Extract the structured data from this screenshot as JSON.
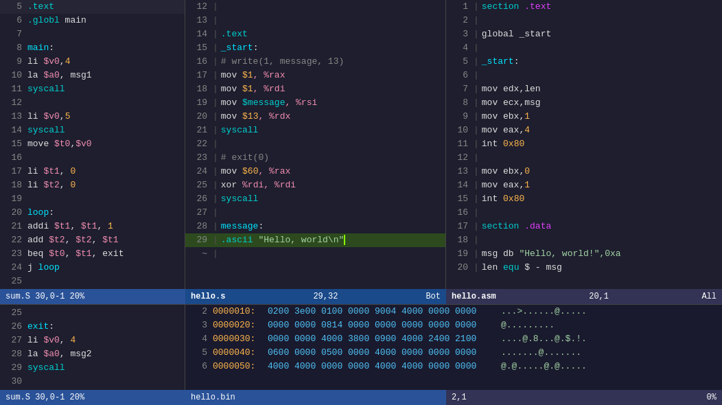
{
  "colors": {
    "bg": "#1e1e2e",
    "status_blue": "#2a5298",
    "status_dark": "#1a4a8a"
  },
  "pane_left": {
    "lines": [
      {
        "num": "5",
        "content": [
          {
            "t": "  .text",
            "c": "c-cyan"
          }
        ]
      },
      {
        "num": "6",
        "content": [
          {
            "t": "  .globl ",
            "c": "c-cyan"
          },
          {
            "t": "main",
            "c": "c-white"
          }
        ]
      },
      {
        "num": "7",
        "content": []
      },
      {
        "num": "8",
        "content": [
          {
            "t": "main",
            "c": "c-label"
          },
          {
            "t": ":",
            "c": "c-white"
          }
        ]
      },
      {
        "num": "9",
        "content": [
          {
            "t": "  li ",
            "c": "c-white"
          },
          {
            "t": "$v0",
            "c": "c-reg"
          },
          {
            "t": ",",
            "c": "c-white"
          },
          {
            "t": "4",
            "c": "c-num"
          }
        ]
      },
      {
        "num": "10",
        "content": [
          {
            "t": "  la ",
            "c": "c-white"
          },
          {
            "t": "$a0",
            "c": "c-reg"
          },
          {
            "t": ", msg1",
            "c": "c-white"
          }
        ]
      },
      {
        "num": "11",
        "content": [
          {
            "t": "  syscall",
            "c": "c-cyan"
          }
        ]
      },
      {
        "num": "12",
        "content": []
      },
      {
        "num": "13",
        "content": [
          {
            "t": "  li ",
            "c": "c-white"
          },
          {
            "t": "$v0",
            "c": "c-reg"
          },
          {
            "t": ",",
            "c": "c-white"
          },
          {
            "t": "5",
            "c": "c-num"
          }
        ]
      },
      {
        "num": "14",
        "content": [
          {
            "t": "  syscall",
            "c": "c-cyan"
          }
        ]
      },
      {
        "num": "15",
        "content": [
          {
            "t": "  move ",
            "c": "c-white"
          },
          {
            "t": "$t0",
            "c": "c-reg"
          },
          {
            "t": ",",
            "c": "c-white"
          },
          {
            "t": "$v0",
            "c": "c-reg"
          }
        ]
      },
      {
        "num": "16",
        "content": []
      },
      {
        "num": "17",
        "content": [
          {
            "t": "  li ",
            "c": "c-white"
          },
          {
            "t": "$t1",
            "c": "c-reg"
          },
          {
            "t": ", ",
            "c": "c-white"
          },
          {
            "t": "0",
            "c": "c-num"
          }
        ]
      },
      {
        "num": "18",
        "content": [
          {
            "t": "  li ",
            "c": "c-white"
          },
          {
            "t": "$t2",
            "c": "c-reg"
          },
          {
            "t": ", ",
            "c": "c-white"
          },
          {
            "t": "0",
            "c": "c-num"
          }
        ]
      },
      {
        "num": "19",
        "content": []
      },
      {
        "num": "20",
        "content": [
          {
            "t": "loop",
            "c": "c-label"
          },
          {
            "t": ":",
            "c": "c-white"
          }
        ]
      },
      {
        "num": "21",
        "content": [
          {
            "t": "  addi ",
            "c": "c-white"
          },
          {
            "t": "$t1",
            "c": "c-reg"
          },
          {
            "t": ", ",
            "c": "c-white"
          },
          {
            "t": "$t1",
            "c": "c-reg"
          },
          {
            "t": ", ",
            "c": "c-white"
          },
          {
            "t": "1",
            "c": "c-num"
          }
        ]
      },
      {
        "num": "22",
        "content": [
          {
            "t": "  add  ",
            "c": "c-white"
          },
          {
            "t": "$t2",
            "c": "c-reg"
          },
          {
            "t": ", ",
            "c": "c-white"
          },
          {
            "t": "$t2",
            "c": "c-reg"
          },
          {
            "t": ", ",
            "c": "c-white"
          },
          {
            "t": "$t1",
            "c": "c-reg"
          }
        ]
      },
      {
        "num": "23",
        "content": [
          {
            "t": "  beq  ",
            "c": "c-white"
          },
          {
            "t": "$t0",
            "c": "c-reg"
          },
          {
            "t": ", ",
            "c": "c-white"
          },
          {
            "t": "$t1",
            "c": "c-reg"
          },
          {
            "t": ", exit",
            "c": "c-white"
          }
        ]
      },
      {
        "num": "24",
        "content": [
          {
            "t": "  j    ",
            "c": "c-white"
          },
          {
            "t": "loop",
            "c": "c-label"
          }
        ]
      },
      {
        "num": "25",
        "content": []
      },
      {
        "num": "26",
        "content": [
          {
            "t": "exit",
            "c": "c-label"
          },
          {
            "t": ":",
            "c": "c-white"
          }
        ]
      },
      {
        "num": "27",
        "content": [
          {
            "t": "  li ",
            "c": "c-white"
          },
          {
            "t": "$v0",
            "c": "c-reg"
          },
          {
            "t": ", ",
            "c": "c-white"
          },
          {
            "t": "4",
            "c": "c-num"
          }
        ]
      },
      {
        "num": "28",
        "content": [
          {
            "t": "  la ",
            "c": "c-white"
          },
          {
            "t": "$a0",
            "c": "c-reg"
          },
          {
            "t": ", msg2",
            "c": "c-white"
          }
        ]
      },
      {
        "num": "29",
        "content": [
          {
            "t": "  syscall",
            "c": "c-cyan"
          }
        ]
      },
      {
        "num": "30",
        "content": []
      }
    ],
    "status": "sum.S          30,0-1       20%"
  },
  "pane_middle": {
    "lines": [
      {
        "num": "12",
        "content": []
      },
      {
        "num": "13",
        "content": []
      },
      {
        "num": "14",
        "content": [
          {
            "t": "  .text",
            "c": "c-cyan"
          }
        ]
      },
      {
        "num": "15",
        "content": [
          {
            "t": "_start",
            "c": "c-label"
          },
          {
            "t": ":",
            "c": "c-white"
          }
        ]
      },
      {
        "num": "16",
        "content": [
          {
            "t": "  # write(1, message, 13)",
            "c": "c-comment"
          }
        ]
      },
      {
        "num": "17",
        "content": [
          {
            "t": "  mov    ",
            "c": "c-white"
          },
          {
            "t": "$1",
            "c": "c-num"
          },
          {
            "t": ", %rax",
            "c": "c-reg"
          }
        ]
      },
      {
        "num": "18",
        "content": [
          {
            "t": "  mov    ",
            "c": "c-white"
          },
          {
            "t": "$1",
            "c": "c-num"
          },
          {
            "t": ", %rdi",
            "c": "c-reg"
          }
        ]
      },
      {
        "num": "19",
        "content": [
          {
            "t": "  mov    ",
            "c": "c-white"
          },
          {
            "t": "$message",
            "c": "c-cyan"
          },
          {
            "t": ", %rsi",
            "c": "c-reg"
          }
        ]
      },
      {
        "num": "20",
        "content": [
          {
            "t": "  mov    ",
            "c": "c-white"
          },
          {
            "t": "$13",
            "c": "c-num"
          },
          {
            "t": ", %rdx",
            "c": "c-reg"
          }
        ]
      },
      {
        "num": "21",
        "content": [
          {
            "t": "  syscall",
            "c": "c-cyan"
          }
        ]
      },
      {
        "num": "22",
        "content": []
      },
      {
        "num": "23",
        "content": [
          {
            "t": "  # exit(0)",
            "c": "c-comment"
          }
        ]
      },
      {
        "num": "24",
        "content": [
          {
            "t": "  mov    ",
            "c": "c-white"
          },
          {
            "t": "$60",
            "c": "c-num"
          },
          {
            "t": ", %rax",
            "c": "c-reg"
          }
        ]
      },
      {
        "num": "25",
        "content": [
          {
            "t": "  xor    ",
            "c": "c-white"
          },
          {
            "t": "%rdi",
            "c": "c-reg"
          },
          {
            "t": ", %rdi",
            "c": "c-reg"
          }
        ]
      },
      {
        "num": "26",
        "content": [
          {
            "t": "  syscall",
            "c": "c-cyan"
          }
        ]
      },
      {
        "num": "27",
        "content": []
      },
      {
        "num": "28",
        "content": [
          {
            "t": "message",
            "c": "c-label"
          },
          {
            "t": ":",
            "c": "c-white"
          }
        ]
      },
      {
        "num": "29",
        "content": [
          {
            "t": "  .ascii ",
            "c": "c-cyan"
          },
          {
            "t": "\"Hello, world\\n\"",
            "c": "c-string"
          },
          {
            "t": "",
            "c": "cursor-block"
          }
        ],
        "highlight": true
      },
      {
        "num": "~",
        "content": []
      }
    ],
    "status_filename": "hello.s",
    "status_pos": "29,32",
    "status_bot": "Bot"
  },
  "pane_right": {
    "lines": [
      {
        "num": "1",
        "content": [
          {
            "t": "section",
            "c": "c-cyan"
          },
          {
            "t": " .text",
            "c": "c-magenta"
          }
        ]
      },
      {
        "num": "2",
        "content": []
      },
      {
        "num": "3",
        "content": [
          {
            "t": "  global  _start",
            "c": "c-white"
          }
        ]
      },
      {
        "num": "4",
        "content": []
      },
      {
        "num": "5",
        "content": [
          {
            "t": "_start",
            "c": "c-label"
          },
          {
            "t": ":",
            "c": "c-white"
          }
        ]
      },
      {
        "num": "6",
        "content": []
      },
      {
        "num": "7",
        "content": [
          {
            "t": "  mov     edx,len",
            "c": "c-white"
          }
        ]
      },
      {
        "num": "8",
        "content": [
          {
            "t": "  mov     ecx,msg",
            "c": "c-white"
          }
        ]
      },
      {
        "num": "9",
        "content": [
          {
            "t": "  mov     ebx,",
            "c": "c-white"
          },
          {
            "t": "1",
            "c": "c-num"
          }
        ]
      },
      {
        "num": "10",
        "content": [
          {
            "t": "  mov     eax,",
            "c": "c-white"
          },
          {
            "t": "4",
            "c": "c-num"
          }
        ]
      },
      {
        "num": "11",
        "content": [
          {
            "t": "  int     ",
            "c": "c-white"
          },
          {
            "t": "0x80",
            "c": "c-num"
          }
        ]
      },
      {
        "num": "12",
        "content": []
      },
      {
        "num": "13",
        "content": [
          {
            "t": "  mov     ebx,",
            "c": "c-white"
          },
          {
            "t": "0",
            "c": "c-num"
          }
        ]
      },
      {
        "num": "14",
        "content": [
          {
            "t": "  mov     eax,",
            "c": "c-white"
          },
          {
            "t": "1",
            "c": "c-num"
          }
        ]
      },
      {
        "num": "15",
        "content": [
          {
            "t": "  int     ",
            "c": "c-white"
          },
          {
            "t": "0x80",
            "c": "c-num"
          }
        ]
      },
      {
        "num": "16",
        "content": []
      },
      {
        "num": "17",
        "content": [
          {
            "t": "section",
            "c": "c-cyan"
          },
          {
            "t": " .data",
            "c": "c-magenta"
          }
        ]
      },
      {
        "num": "18",
        "content": []
      },
      {
        "num": "19",
        "content": [
          {
            "t": "msg db     ",
            "c": "c-white"
          },
          {
            "t": "\"Hello, world!\",0xa",
            "c": "c-string"
          }
        ]
      },
      {
        "num": "20",
        "content": [
          {
            "t": "len ",
            "c": "c-white"
          },
          {
            "t": "equ",
            "c": "c-cyan"
          },
          {
            "t": "     $ - msg",
            "c": "c-white"
          }
        ]
      }
    ],
    "status_filename": "hello.asm",
    "status_pos": "20,1",
    "status_bot": "All"
  },
  "hex_section": {
    "lines": [
      {
        "num": "2",
        "addr": "0000010:",
        "bytes": "0200 3e00 0100 0000 9004 4000 0000 0000",
        "ascii": "...>......@....."
      },
      {
        "num": "3",
        "addr": "0000020:",
        "bytes": "0000 0000 0814 0000 0000 0000 0000 0000",
        "ascii": "@........."
      },
      {
        "num": "4",
        "addr": "0000030:",
        "bytes": "0000 0000 4000 3800 0900 4000 2400 2100",
        "ascii": "....@.8...@.$.!."
      },
      {
        "num": "5",
        "addr": "0000040:",
        "bytes": "0600 0000 0500 0000 4000 0000 0000 0000",
        "ascii": ".......@......."
      },
      {
        "num": "6",
        "addr": "0000050:",
        "bytes": "4000 4000 0000 0000 4000 4000 0000 0000",
        "ascii": "@.@.....@.@....."
      }
    ]
  },
  "bottom_status_left": "sum.S          30,0-1       20%",
  "bottom_status_middle": "hello.bin",
  "bottom_status_right_pos": "2,1",
  "bottom_status_right_pct": "0%"
}
